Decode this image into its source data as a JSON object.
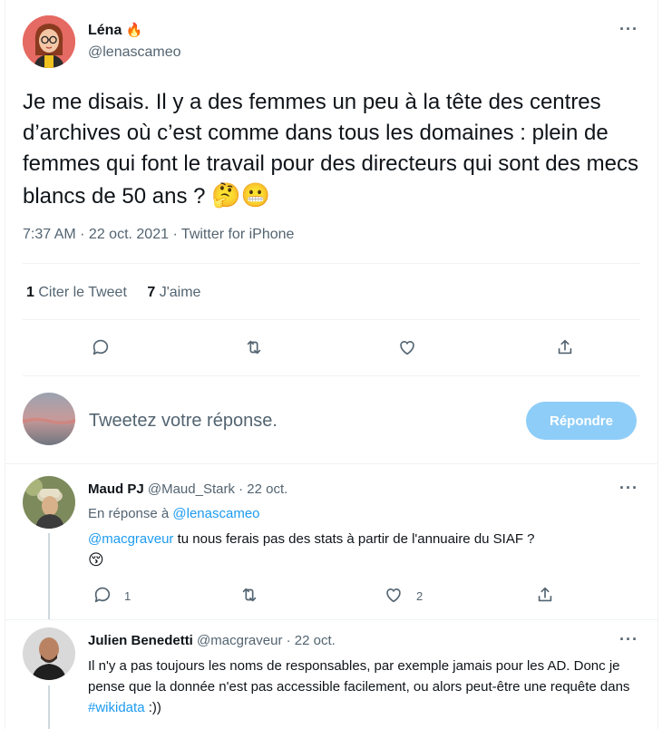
{
  "tweet": {
    "author_name": "Léna",
    "author_badge": "🔥",
    "author_handle": "@lenascameo",
    "text": "Je me disais. Il y a des femmes un peu à la tête des centres d’archives où c’est comme dans tous les domaines : plein de femmes qui font le travail pour des directeurs qui sont des mecs blancs de 50 ans ?",
    "text_emojis": "🤔😬",
    "meta": "7:37 AM · 22 oct. 2021 · Twitter for iPhone",
    "stats": {
      "retweets_count": "1",
      "retweets_label": "Citer le Tweet",
      "likes_count": "7",
      "likes_label": "J'aime"
    },
    "actions": [
      "reply-icon",
      "retweet-icon",
      "like-icon",
      "share-icon"
    ]
  },
  "reply_box": {
    "placeholder": "Tweetez votre réponse.",
    "button_label": "Répondre"
  },
  "replies": [
    {
      "name": "Maud PJ",
      "handle": "@Maud_Stark",
      "date": "· 22 oct.",
      "in_reply_prefix": "En réponse à",
      "in_reply_handle": "@lenascameo",
      "mention": "@macgraveur",
      "text": " tu nous ferais pas des stats à partir de l'annuaire du SIAF ?",
      "emoji": "😚",
      "reply_count": "1",
      "like_count": "2"
    },
    {
      "name": "Julien Benedetti",
      "handle": "@macgraveur",
      "date": "· 22 oct.",
      "text": "Il n'y a pas toujours les noms de responsables, par exemple jamais pour les AD. Donc je pense que la donnée n'est pas accessible facilement, ou alors peut-être une requête dans ",
      "hashtag": "#wikidata",
      "text_end": " :))"
    }
  ],
  "colors": {
    "accent": "#1d9bf0",
    "muted_text": "#536471",
    "button_disabled": "#8ecdf8",
    "divider": "#eff3f4"
  }
}
